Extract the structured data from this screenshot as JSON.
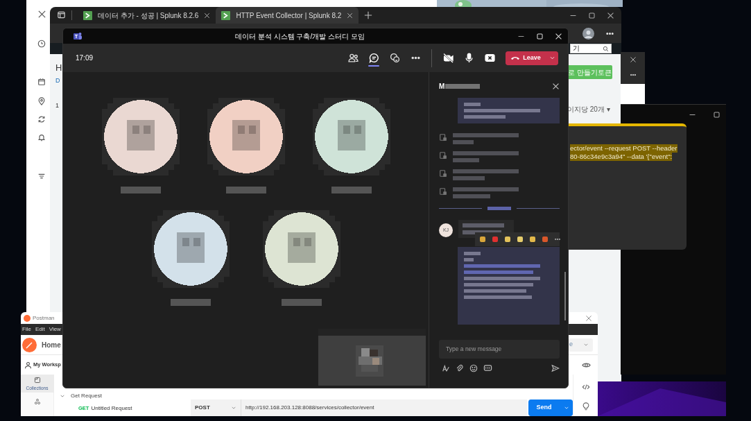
{
  "browser": {
    "tabs": [
      {
        "title": "데이터 추가 - 성공 | Splunk 8.2.6",
        "selected": false
      },
      {
        "title": "HTTP Event Collector | Splunk 8.2",
        "selected": true
      }
    ],
    "page": {
      "fragments": [
        "H",
        "D",
        "1"
      ],
      "search_value": "기",
      "token_button": "로 만들기토큰",
      "page_size": "이지당 20개 ▾"
    }
  },
  "terminal": {
    "lines": [
      "ector/event --request POST --header",
      "80-86c34e9c3a94\" --data '{\"event\":"
    ]
  },
  "postman": {
    "title": "Postman",
    "menu": [
      "File",
      "Edit",
      "View"
    ],
    "home": "Home",
    "workspace": "My Worksp",
    "environment": "e",
    "sidebar": [
      {
        "label": "Collections",
        "selected": true
      }
    ],
    "tree": [
      {
        "label": "Get Request",
        "expanded": true,
        "children": [
          {
            "method": "GET",
            "label": "Untitled Request"
          }
        ]
      }
    ],
    "method": "POST",
    "url": "http://192.168.203.128:8088/services/collector/event",
    "send": "Send"
  },
  "teams": {
    "title": "데이터 분석 시스템 구축/개발 스터디 모임",
    "time": "17:09",
    "toolbar": [
      {
        "kind": "people",
        "selected": false
      },
      {
        "kind": "chat",
        "selected": true
      },
      {
        "kind": "reactions",
        "selected": false
      },
      {
        "kind": "more",
        "selected": false
      }
    ],
    "leave": "Leave",
    "participants": [
      {
        "color": "#ead8d2"
      },
      {
        "color": "#f1d0c4"
      },
      {
        "color": "#cfe3d8"
      },
      {
        "color": "#d3e1ea"
      },
      {
        "color": "#dde4d3"
      }
    ],
    "chat": {
      "title": "M",
      "avatar_initials": "KJ",
      "placeholder": "Type a new message"
    }
  }
}
